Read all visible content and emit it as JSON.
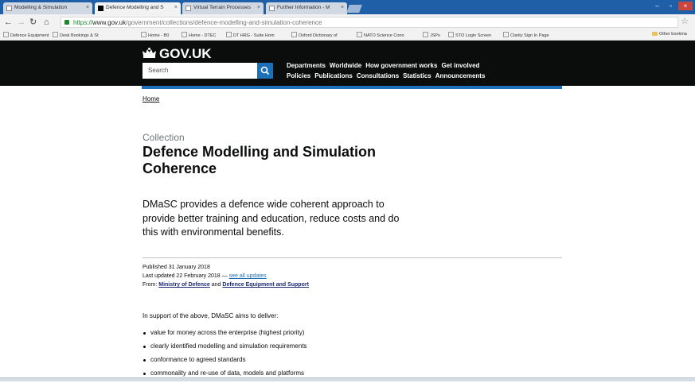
{
  "browser": {
    "tabs": [
      {
        "label": "Modelling & Simulation"
      },
      {
        "label": "Defence Modelling and S"
      },
      {
        "label": "Virtual Terrain Processes"
      },
      {
        "label": "Further Information - M"
      }
    ],
    "url_scheme": "https://",
    "url_host": "www.gov.uk",
    "url_path": "/government/collections/defence-modelling-and-simulation-coherence",
    "bookmarks": [
      "Defence Equipment",
      "Desk Bookings & St",
      "Home - B0",
      "Home - DTEC",
      "DT HRG - Suite Hom",
      "Oxford Dictionary of",
      "NATO Science Conn",
      "JSPs",
      "STO Login Screen",
      "Clarity Sign In Page"
    ],
    "other_bookmarks": "Other bookma"
  },
  "header": {
    "logo": "GOV.UK",
    "search_placeholder": "Search",
    "nav_row1": [
      "Departments",
      "Worldwide",
      "How government works",
      "Get involved"
    ],
    "nav_row2": [
      "Policies",
      "Publications",
      "Consultations",
      "Statistics",
      "Announcements"
    ]
  },
  "breadcrumb": "Home",
  "page": {
    "kicker": "Collection",
    "title": "Defence Modelling and Simulation Coherence",
    "lede": "DMaSC provides a defence wide coherent approach to provide better training and education, reduce costs and do this with environmental benefits.",
    "published": "Published 31 January 2018",
    "updated": "Last updated 22 February 2018 —",
    "see_updates": "see all updates",
    "from_label": "From:",
    "org1": "Ministry of Defence",
    "and": "and",
    "org2": "Defence Equipment and Support",
    "intro": "In support of the above, DMaSC aims to deliver:",
    "bullets": [
      "value for money across the enterprise (highest priority)",
      "clearly identified modelling and simulation requirements",
      "conformance to agreed standards",
      "commonality and re-use of data, models and platforms"
    ]
  }
}
